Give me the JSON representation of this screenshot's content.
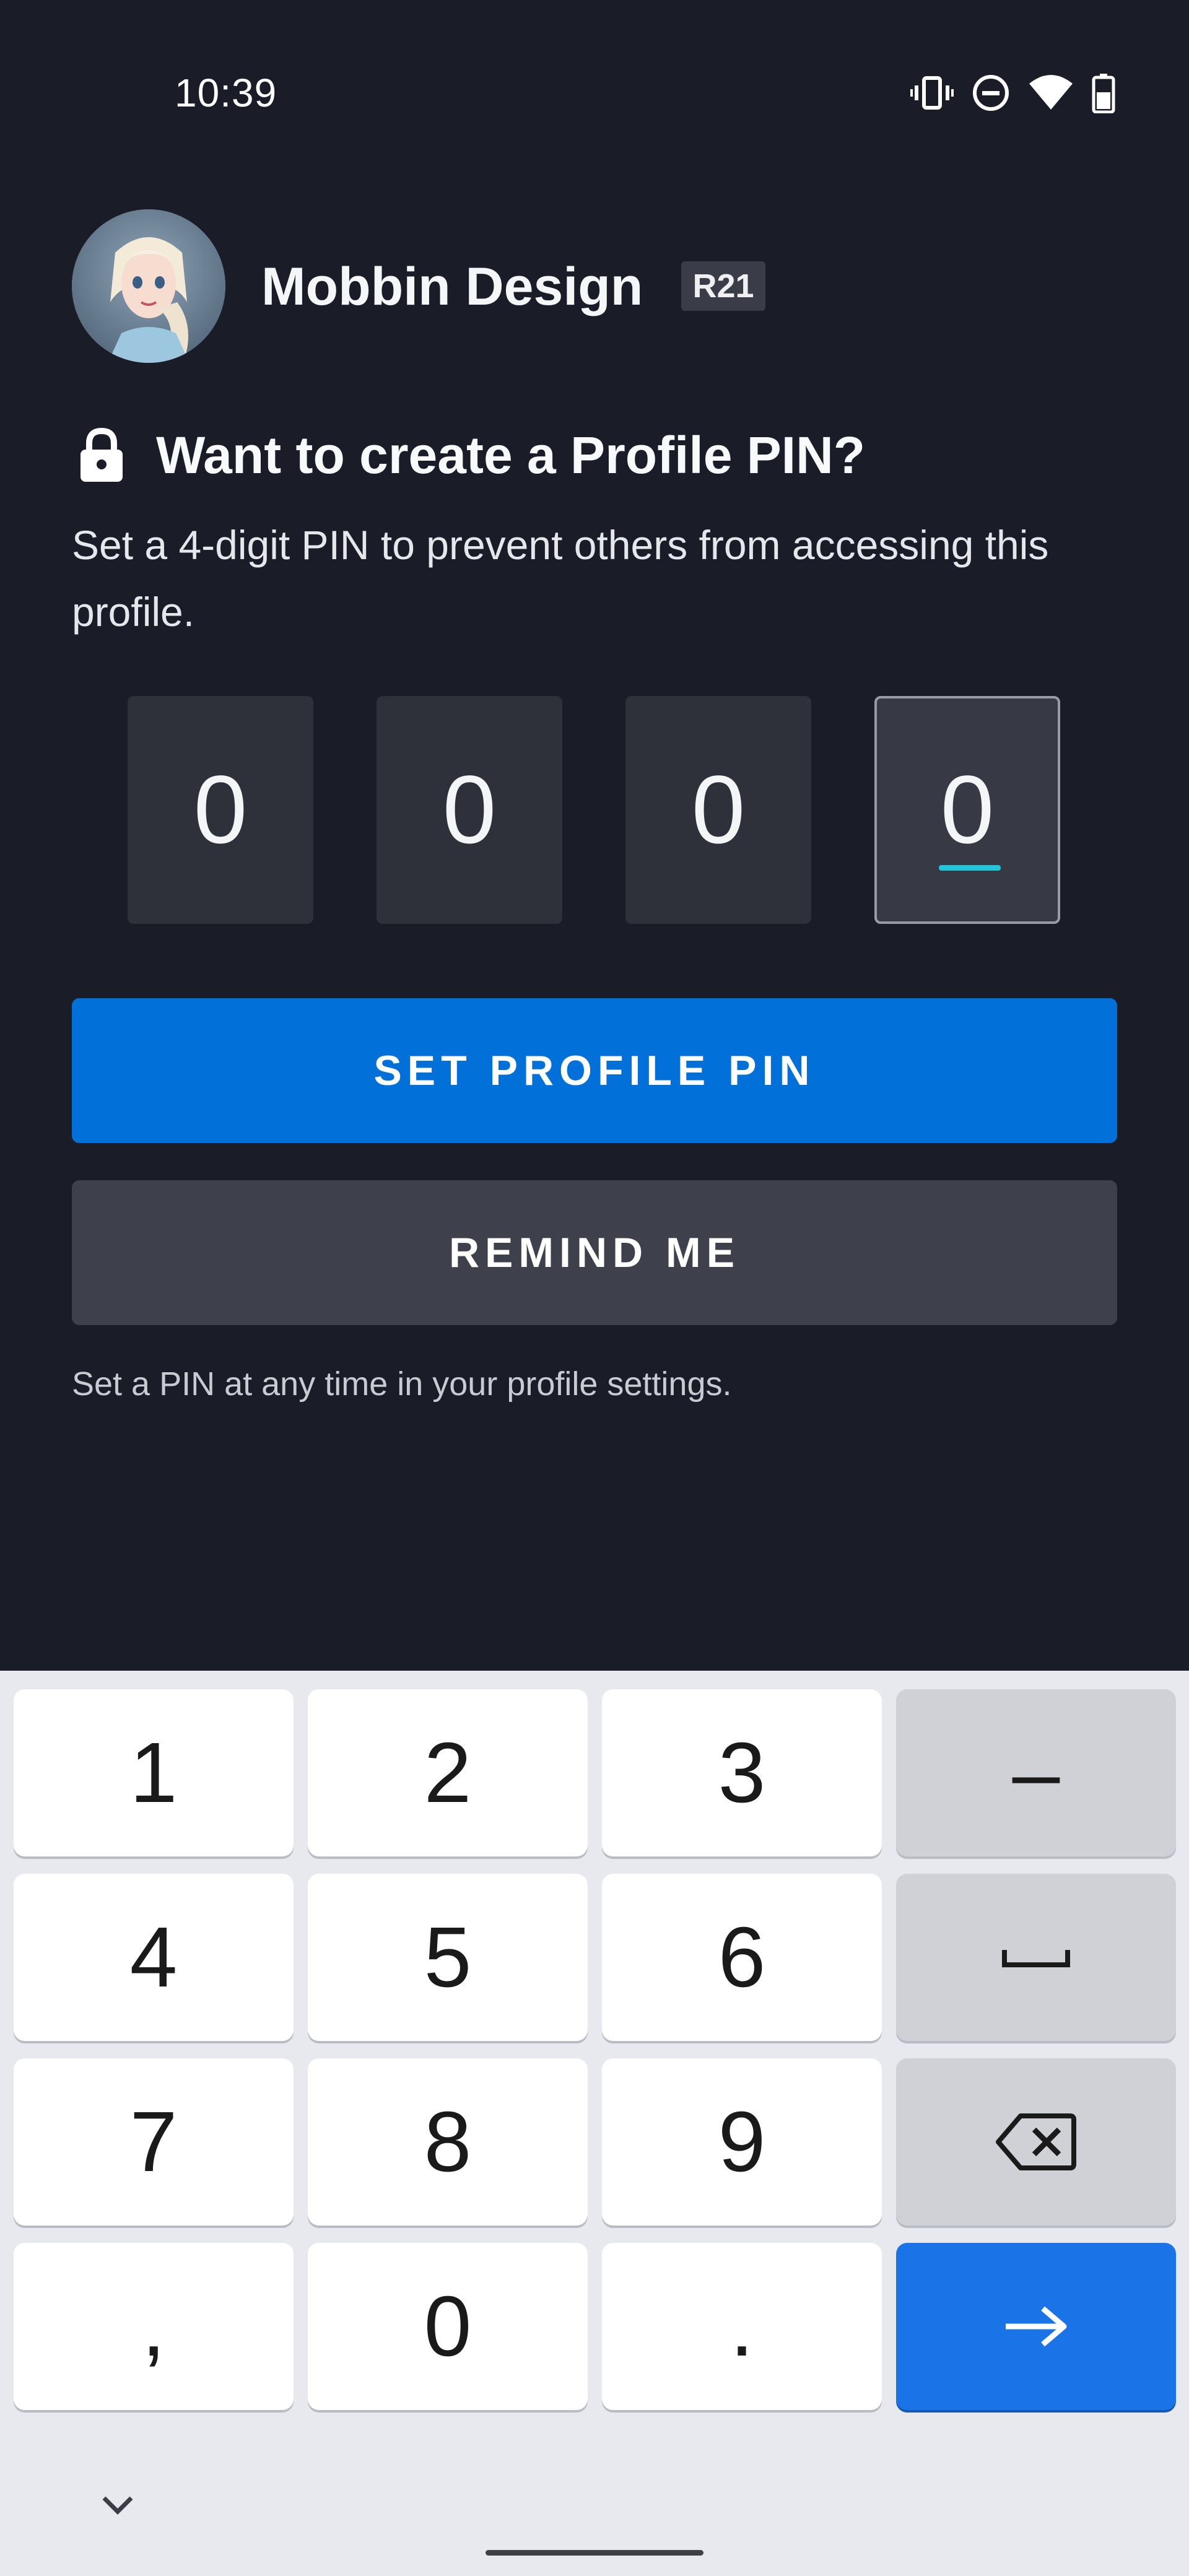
{
  "status_bar": {
    "time": "10:39",
    "icons": [
      "vibrate-icon",
      "do-not-disturb-icon",
      "wifi-icon",
      "battery-icon"
    ]
  },
  "profile": {
    "name": "Mobbin Design",
    "rating": "R21"
  },
  "prompt": {
    "heading": "Want to create a Profile PIN?",
    "subtitle": "Set a 4-digit PIN to prevent others from accessing this profile."
  },
  "pin": {
    "digits": [
      "0",
      "0",
      "0",
      "0"
    ],
    "active_index": 3
  },
  "buttons": {
    "set_pin": "SET PROFILE PIN",
    "remind": "REMIND ME"
  },
  "hint": "Set a PIN at any time in your profile settings.",
  "keyboard": {
    "rows": [
      [
        "1",
        "2",
        "3",
        "–"
      ],
      [
        "4",
        "5",
        "6",
        "space"
      ],
      [
        "7",
        "8",
        "9",
        "backspace"
      ],
      [
        ",",
        "0",
        ".",
        "enter"
      ]
    ]
  },
  "colors": {
    "background": "#1a1c28",
    "primary_button": "#0171d9",
    "secondary_button": "#3e404b",
    "cursor": "#21c6da",
    "keyboard_action": "#1b73e8"
  }
}
